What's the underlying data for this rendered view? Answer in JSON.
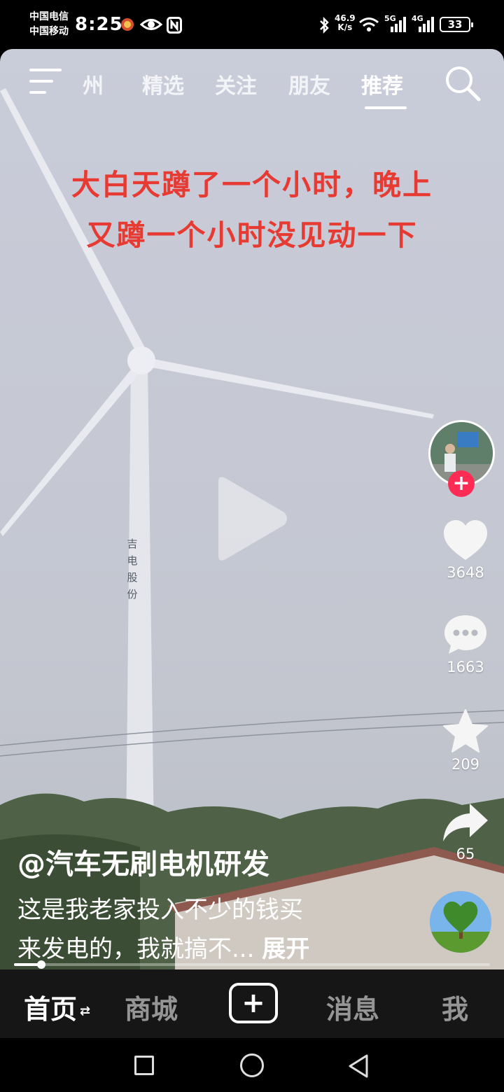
{
  "status_bar": {
    "carrier_1": "中国电信",
    "carrier_2": "中国移动",
    "time": "8:25",
    "net_speed_value": "46.9",
    "net_speed_unit": "K/s",
    "sig1_label": "5G",
    "sig2_label": "4G",
    "battery": "33"
  },
  "top_nav": {
    "tabs": [
      "州",
      "精选",
      "关注",
      "朋友",
      "推荐"
    ],
    "active_tab": "推荐"
  },
  "video": {
    "caption_line1": "大白天蹲了一个小时，晚上",
    "caption_line2": "又蹲一个小时没见动一下",
    "tower_text": [
      "吉",
      "电",
      "股",
      "份"
    ],
    "progress_fraction": 0.057
  },
  "side_actions": {
    "follow_label": "+",
    "likes": "3648",
    "comments": "1663",
    "favorites": "209",
    "shares": "65"
  },
  "post": {
    "username": "@汽车无刷电机研发",
    "description_line1": "这是我老家投入不少的钱买",
    "description_line2": "来发电的，我就搞不...",
    "expand_label": "展开"
  },
  "bottom_tabs": {
    "home": "首页",
    "home_arrow": "⇄",
    "mall": "商城",
    "create": "+",
    "messages": "消息",
    "me": "我"
  },
  "colors": {
    "caption": "#e63a32",
    "follow_button": "#fe2c55",
    "tab_bar": "#161616"
  }
}
